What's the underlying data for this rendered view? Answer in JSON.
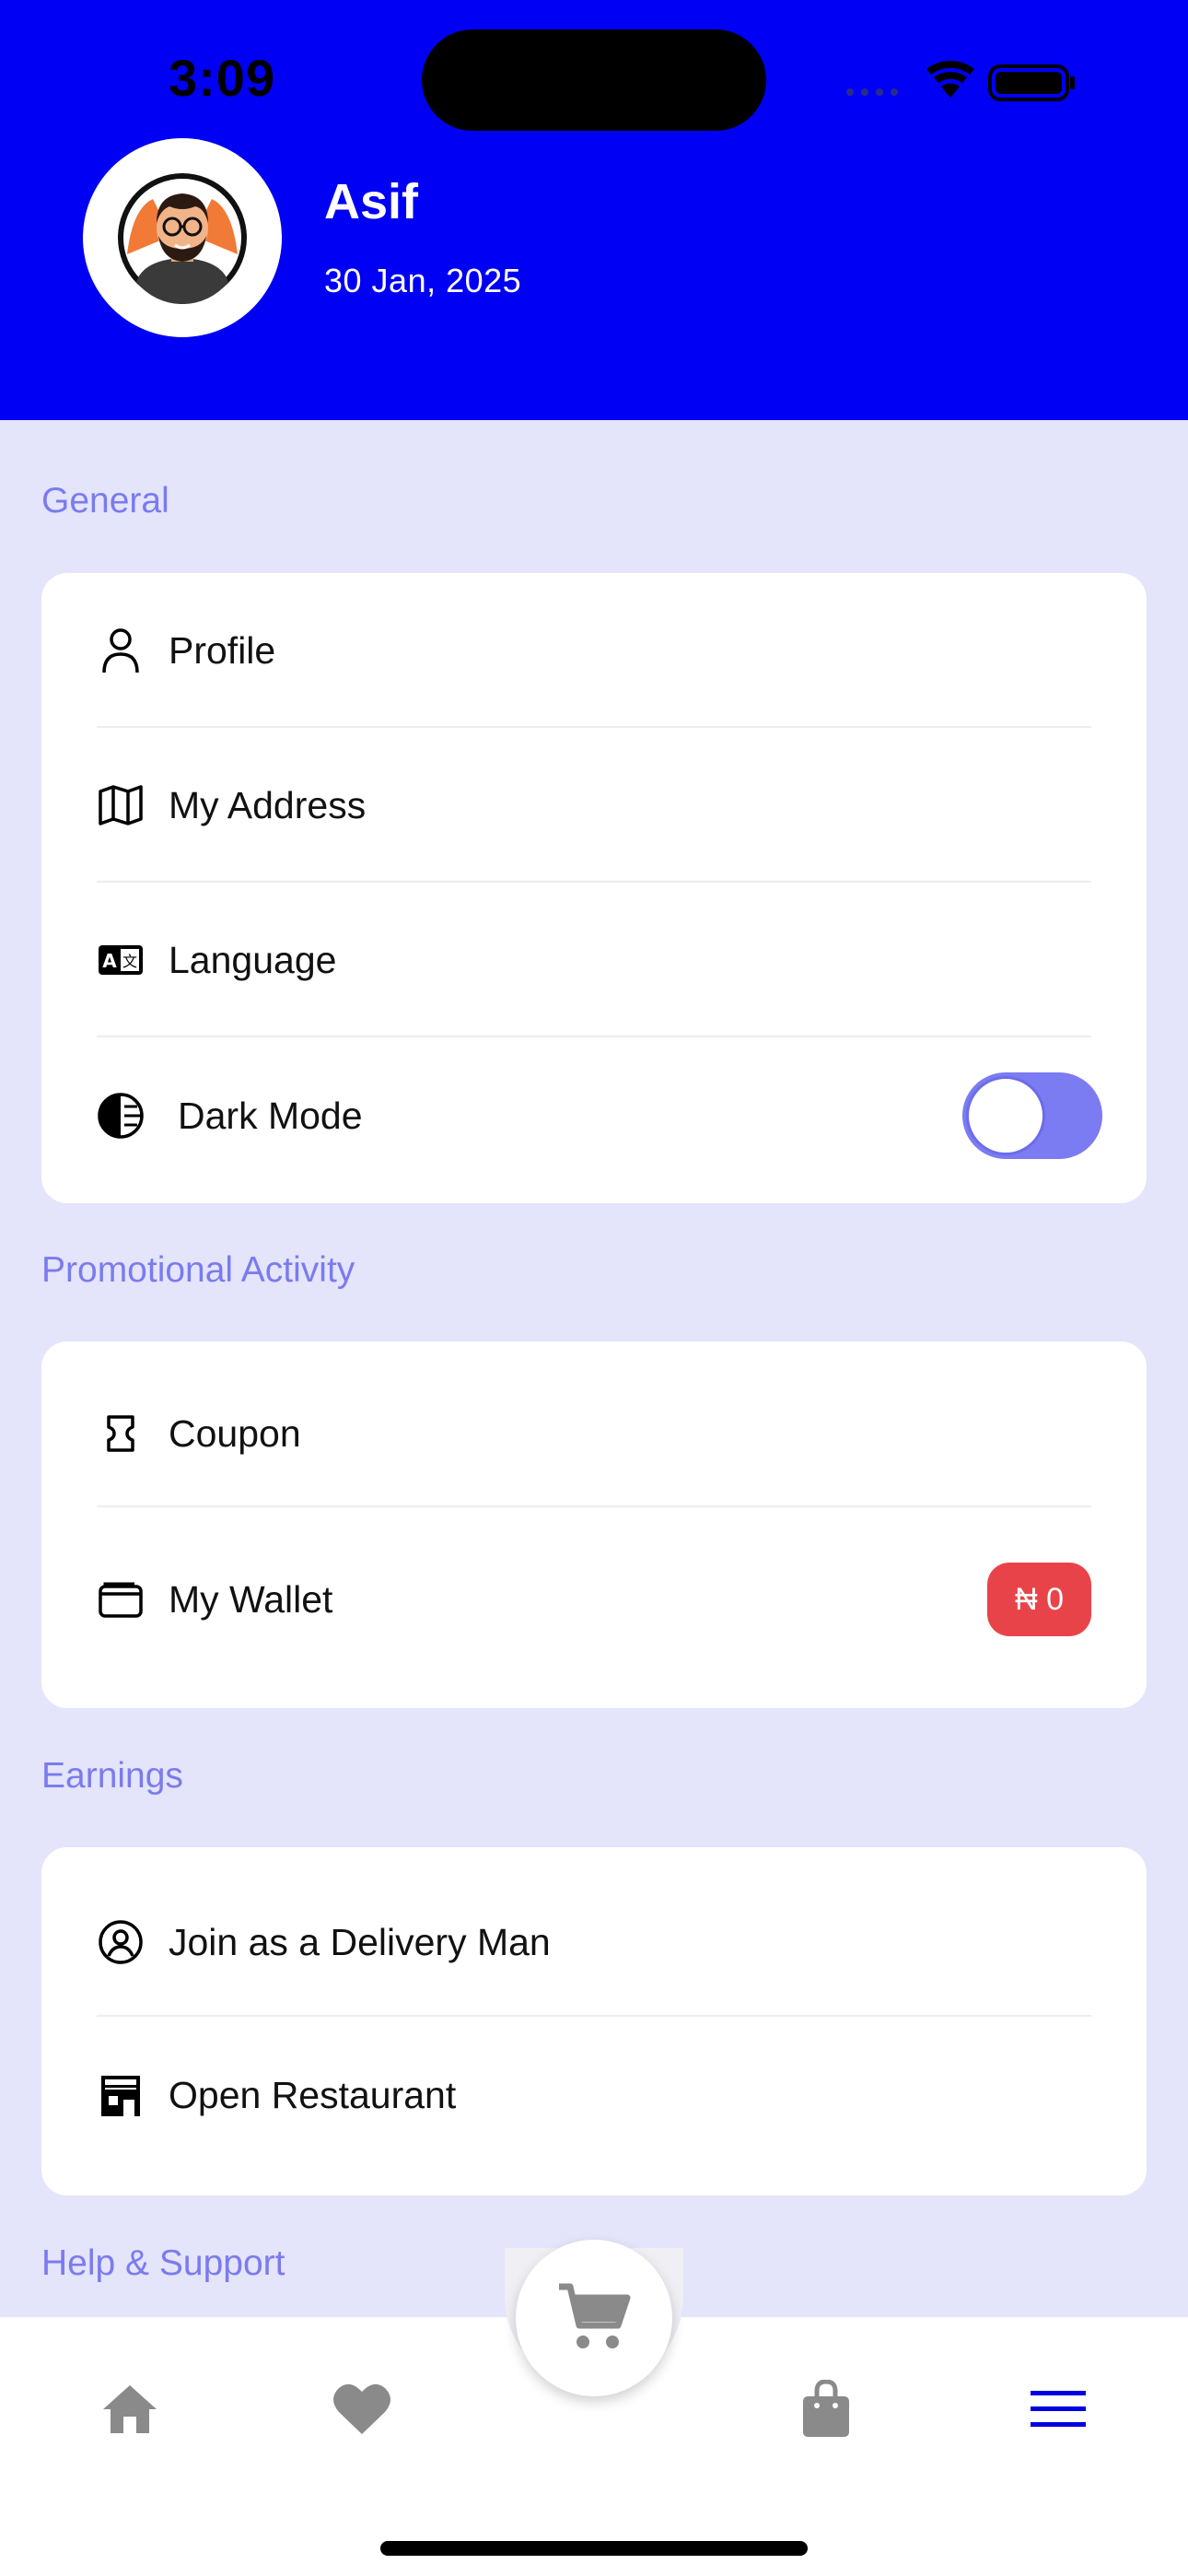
{
  "status_bar": {
    "time": "3:09"
  },
  "profile": {
    "name": "Asif",
    "date": "30 Jan, 2025"
  },
  "sections": {
    "general": {
      "title": "General",
      "items": [
        {
          "label": "Profile",
          "icon": "person-icon"
        },
        {
          "label": "My Address",
          "icon": "map-icon"
        },
        {
          "label": "Language",
          "icon": "translate-icon"
        },
        {
          "label": "Dark Mode",
          "icon": "contrast-icon"
        }
      ]
    },
    "promotional": {
      "title": "Promotional Activity",
      "items": [
        {
          "label": "Coupon",
          "icon": "coupon-icon"
        },
        {
          "label": "My Wallet",
          "icon": "wallet-icon"
        }
      ],
      "wallet_balance": "₦ 0"
    },
    "earnings": {
      "title": "Earnings",
      "items": [
        {
          "label": "Join as a Delivery Man",
          "icon": "user-circle-icon"
        },
        {
          "label": "Open Restaurant",
          "icon": "store-icon"
        }
      ]
    },
    "help": {
      "title": "Help & Support"
    }
  },
  "dark_mode_enabled": false,
  "bottom_nav": [
    {
      "name": "home",
      "icon": "home-icon"
    },
    {
      "name": "favorites",
      "icon": "heart-icon"
    },
    {
      "name": "cart",
      "icon": "cart-icon"
    },
    {
      "name": "orders",
      "icon": "bag-icon"
    },
    {
      "name": "menu",
      "icon": "menu-icon",
      "active": true
    }
  ],
  "colors": {
    "header": "#0000f5",
    "background": "#e4e4fb",
    "section_title": "#7b7bee",
    "toggle": "#7b7bf2",
    "wallet_badge": "#e9434a",
    "nav_inactive": "#8a8a8a",
    "nav_active": "#0000e0"
  }
}
